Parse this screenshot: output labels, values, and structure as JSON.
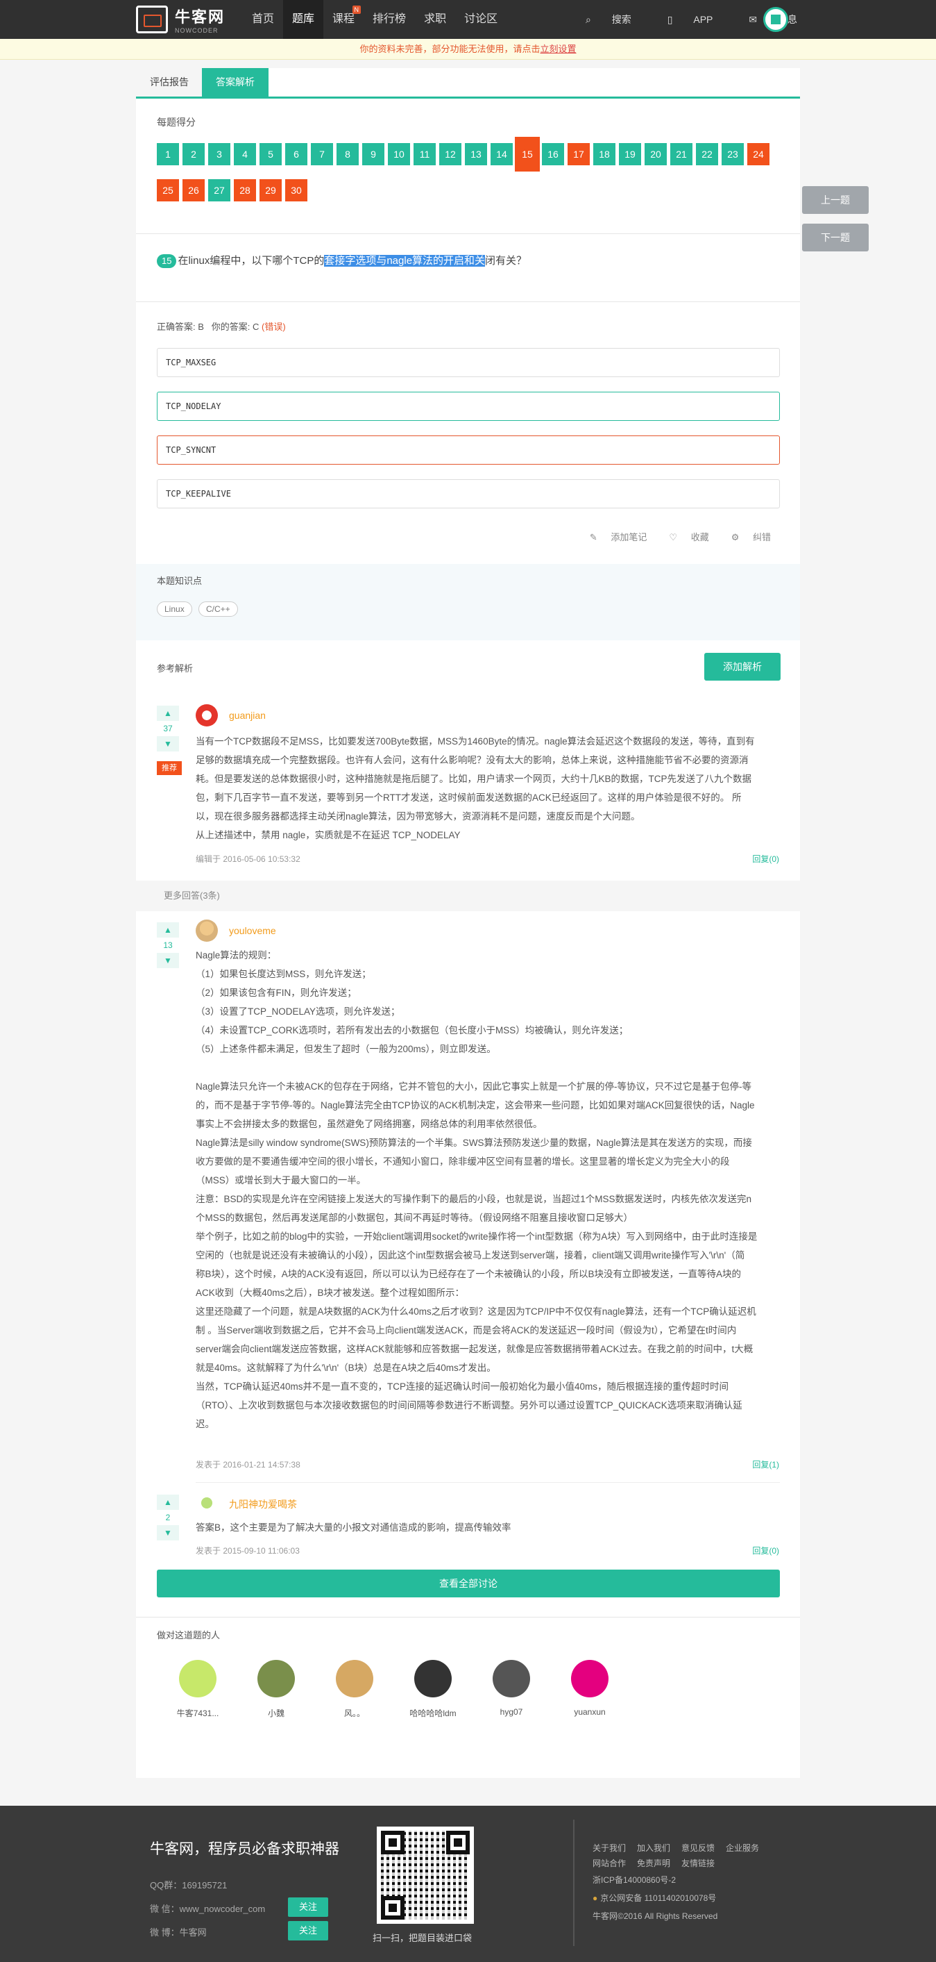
{
  "header": {
    "logo_text": "牛客网",
    "logo_sub": "NOWCODER",
    "nav": [
      "首页",
      "题库",
      "课程",
      "排行榜",
      "求职",
      "讨论区"
    ],
    "nav_active": "题库",
    "nav_badge": "N",
    "right": {
      "search": "搜索",
      "app": "APP",
      "msg": "消息"
    }
  },
  "notice": {
    "text": "你的资料未完善，部分功能无法使用，请点击",
    "link": "立刻设置"
  },
  "tabs": [
    "评估报告",
    "答案解析"
  ],
  "score_title": "每题得分",
  "questions": [
    {
      "n": "1",
      "s": "ok"
    },
    {
      "n": "2",
      "s": "ok"
    },
    {
      "n": "3",
      "s": "ok"
    },
    {
      "n": "4",
      "s": "ok"
    },
    {
      "n": "5",
      "s": "ok"
    },
    {
      "n": "6",
      "s": "ok"
    },
    {
      "n": "7",
      "s": "ok"
    },
    {
      "n": "8",
      "s": "ok"
    },
    {
      "n": "9",
      "s": "ok"
    },
    {
      "n": "10",
      "s": "ok"
    },
    {
      "n": "11",
      "s": "ok"
    },
    {
      "n": "12",
      "s": "ok"
    },
    {
      "n": "13",
      "s": "ok"
    },
    {
      "n": "14",
      "s": "ok"
    },
    {
      "n": "15",
      "s": "cur"
    },
    {
      "n": "16",
      "s": "ok"
    },
    {
      "n": "17",
      "s": "bad"
    },
    {
      "n": "18",
      "s": "ok"
    },
    {
      "n": "19",
      "s": "ok"
    },
    {
      "n": "20",
      "s": "ok"
    },
    {
      "n": "21",
      "s": "ok"
    },
    {
      "n": "22",
      "s": "ok"
    },
    {
      "n": "23",
      "s": "ok"
    },
    {
      "n": "24",
      "s": "bad"
    },
    {
      "n": "25",
      "s": "bad"
    },
    {
      "n": "26",
      "s": "bad"
    },
    {
      "n": "27",
      "s": "ok"
    },
    {
      "n": "28",
      "s": "bad"
    },
    {
      "n": "29",
      "s": "bad"
    },
    {
      "n": "30",
      "s": "bad"
    }
  ],
  "side": {
    "prev": "上一题",
    "next": "下一题"
  },
  "question": {
    "num": "15",
    "pre": "在linux编程中，以下哪个TCP的",
    "hl": "套接字选项与nagle算法的开启和关",
    "post": "闭有关？"
  },
  "answer": {
    "correct_label": "正确答案: B",
    "yours_label": "你的答案: C",
    "wrong": "(错误)"
  },
  "options": [
    "TCP_MAXSEG",
    "TCP_NODELAY",
    "TCP_SYNCNT",
    "TCP_KEEPALIVE"
  ],
  "actions": {
    "note": "添加笔记",
    "fav": "收藏",
    "err": "纠错"
  },
  "knowledge": {
    "title": "本题知识点",
    "tags": [
      "Linux",
      "C/C++"
    ]
  },
  "analysis": {
    "title": "参考解析",
    "add": "添加解析"
  },
  "post1": {
    "user": "guanjian",
    "votes": "37",
    "recommend": "推荐",
    "lines": [
      "当有一个TCP数据段不足MSS，比如要发送700Byte数据，MSS为1460Byte的情况。nagle算法会延迟这个数据段的发送，等待，直到有",
      "足够的数据填充成一个完整数据段。也许有人会问，这有什么影响呢？没有太大的影响，总体上来说，这种措施能节省不必要的资源消",
      "耗。但是要发送的总体数据很小时，这种措施就是拖后腿了。比如，用户请求一个网页，大约十几KB的数据，TCP先发送了八九个数据",
      "包，剩下几百字节一直不发送，要等到另一个RTT才发送，这时候前面发送数据的ACK已经返回了。这样的用户体验是很不好的。 所",
      "以，现在很多服务器都选择主动关闭nagle算法，因为带宽够大，资源消耗不是问题，速度反而是个大问题。",
      "从上述描述中，禁用 nagle，实质就是不在延迟 TCP_NODELAY"
    ],
    "meta": "编辑于 2016-05-06 10:53:32",
    "reply": "回复(0)"
  },
  "more": "更多回答(3条)",
  "post2": {
    "user": "youloveme",
    "votes": "13",
    "lines": [
      "Nagle算法的规则：",
      "（1）如果包长度达到MSS，则允许发送；",
      "（2）如果该包含有FIN，则允许发送；",
      "（3）设置了TCP_NODELAY选项，则允许发送；",
      "（4）未设置TCP_CORK选项时，若所有发出去的小数据包（包长度小于MSS）均被确认，则允许发送；",
      "（5）上述条件都未满足，但发生了超时（一般为200ms），则立即发送。",
      "",
      "Nagle算法只允许一个未被ACK的包存在于网络，它并不管包的大小，因此它事实上就是一个扩展的停-等协议，只不过它是基于包停-等",
      "的，而不是基于字节停-等的。Nagle算法完全由TCP协议的ACK机制决定，这会带来一些问题，比如如果对端ACK回复很快的话，Nagle",
      "事实上不会拼接太多的数据包，虽然避免了网络拥塞，网络总体的利用率依然很低。",
      "Nagle算法是silly window syndrome(SWS)预防算法的一个半集。SWS算法预防发送少量的数据，Nagle算法是其在发送方的实现，而接",
      "收方要做的是不要通告缓冲空间的很小增长，不通知小窗口，除非缓冲区空间有显著的增长。这里显著的增长定义为完全大小的段",
      "（MSS）或增长到大于最大窗口的一半。",
      "注意：BSD的实现是允许在空闲链接上发送大的写操作剩下的最后的小段，也就是说，当超过1个MSS数据发送时，内核先依次发送完n",
      "个MSS的数据包，然后再发送尾部的小数据包，其间不再延时等待。（假设网络不阻塞且接收窗口足够大）",
      "举个例子，比如之前的blog中的实验，一开始client端调用socket的write操作将一个int型数据（称为A块）写入到网络中，由于此时连接是",
      "空闲的（也就是说还没有未被确认的小段），因此这个int型数据会被马上发送到server端，接着，client端又调用write操作写入'\\r\\n'（简",
      "称B块），这个时候，A块的ACK没有返回，所以可以认为已经存在了一个未被确认的小段，所以B块没有立即被发送，一直等待A块的",
      "ACK收到（大概40ms之后），B块才被发送。整个过程如图所示：",
      "这里还隐藏了一个问题，就是A块数据的ACK为什么40ms之后才收到？这是因为TCP/IP中不仅仅有nagle算法，还有一个TCP确认延迟机",
      "制 。当Server端收到数据之后，它并不会马上向client端发送ACK，而是会将ACK的发送延迟一段时间（假设为t），它希望在t时间内",
      "server端会向client端发送应答数据，这样ACK就能够和应答数据一起发送，就像是应答数据捎带着ACK过去。在我之前的时间中，t大概",
      "就是40ms。这就解释了为什么'\\r\\n'（B块）总是在A块之后40ms才发出。",
      "当然，TCP确认延迟40ms并不是一直不变的，TCP连接的延迟确认时间一般初始化为最小值40ms，随后根据连接的重传超时时间",
      "（RTO）、上次收到数据包与本次接收数据包的时间间隔等参数进行不断调整。另外可以通过设置TCP_QUICKACK选项来取消确认延",
      "迟。"
    ],
    "meta": "发表于 2016-01-21 14:57:38",
    "reply": "回复(1)"
  },
  "post3": {
    "user": "九阳神功爱喝茶",
    "votes": "2",
    "lines": [
      "答案B，这个主要是为了解决大量的小报文对通信造成的影响，提高传输效率"
    ],
    "meta": "发表于 2015-09-10 11:06:03",
    "reply": "回复(0)"
  },
  "view_all": "查看全部讨论",
  "people_title": "做对这道题的人",
  "people": [
    "牛客7431...",
    "小魏",
    "风。。",
    "哈哈哈哈ldm",
    "hyg07",
    "yuanxun"
  ],
  "footer": {
    "slogan": "牛客网，程序员必备求职神器",
    "qq": "QQ群：169195721",
    "wechat": "微 信：www_nowcoder_com",
    "weibo": "微 博：牛客网",
    "follow": "关注",
    "qr_caption": "扫一扫，把题目装进口袋",
    "links1": [
      "关于我们",
      "加入我们",
      "意见反馈",
      "企业服务"
    ],
    "links2": [
      "网站合作",
      "免责声明",
      "友情链接"
    ],
    "icp": "浙ICP备14000860号-2",
    "police": "京公网安备 11011402010078号",
    "copy": "牛客网©2016 All Rights Reserved"
  }
}
